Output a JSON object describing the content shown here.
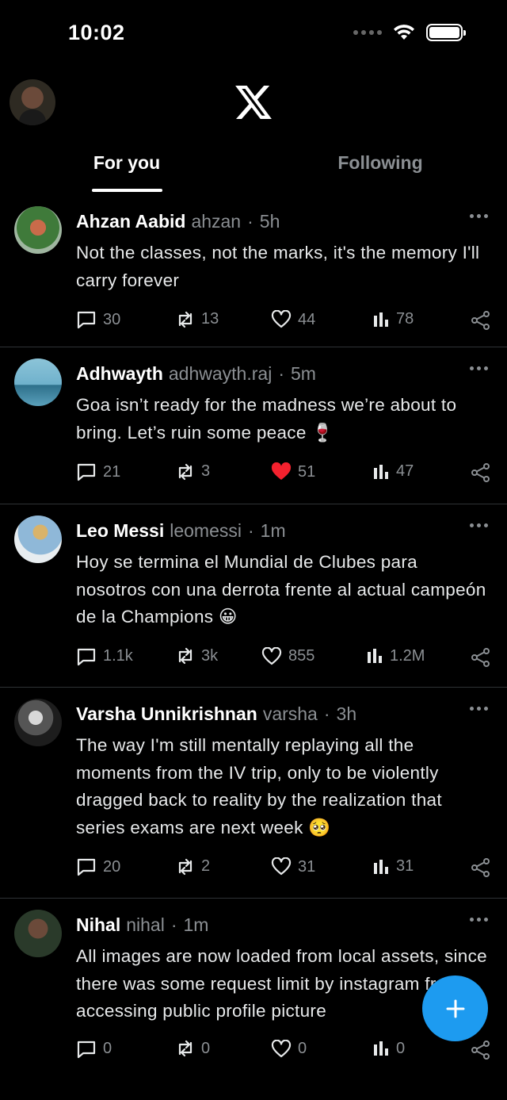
{
  "status_bar": {
    "time": "10:02"
  },
  "header": {
    "logo": "x-logo-icon"
  },
  "tabs": [
    {
      "label": "For you",
      "active": true
    },
    {
      "label": "Following",
      "active": false
    }
  ],
  "posts": [
    {
      "name": "Ahzan Aabid",
      "handle": "ahzan",
      "time": "5h",
      "text": "Not the classes, not the marks, it's the memory I'll carry forever",
      "replies": "30",
      "reposts": "13",
      "likes": "44",
      "views": "78",
      "liked": false
    },
    {
      "name": "Adhwayth",
      "handle": "adhwayth.raj",
      "time": "5m",
      "text": "Goa isn’t ready for the madness we’re about to bring. Let’s ruin some peace 🍷",
      "replies": "21",
      "reposts": "3",
      "likes": "51",
      "views": "47",
      "liked": true
    },
    {
      "name": "Leo Messi",
      "handle": "leomessi",
      "time": "1m",
      "text": "Hoy se termina el Mundial de Clubes para nosotros con una derrota frente al actual campeón de la Champions 😀",
      "replies": "1.1k",
      "reposts": "3k",
      "likes": "855",
      "views": "1.2M",
      "liked": false
    },
    {
      "name": "Varsha Unnikrishnan",
      "handle": "varsha",
      "time": "3h",
      "text": "The way I'm still mentally replaying all the moments from the IV trip, only to be violently dragged back to reality by the realization that series exams are next week 🥺",
      "replies": "20",
      "reposts": "2",
      "likes": "31",
      "views": "31",
      "liked": false
    },
    {
      "name": "Nihal",
      "handle": "nihal",
      "time": "1m",
      "text": "All images are now loaded from local assets, since there was some request limit by instagram from accessing public profile picture",
      "replies": "0",
      "reposts": "0",
      "likes": "0",
      "views": "0",
      "liked": false
    }
  ],
  "fab": {
    "icon": "plus-icon"
  },
  "colors": {
    "accent": "#1d9bf0",
    "like": "#f91880",
    "background": "#000000",
    "muted": "#8b8f93"
  }
}
